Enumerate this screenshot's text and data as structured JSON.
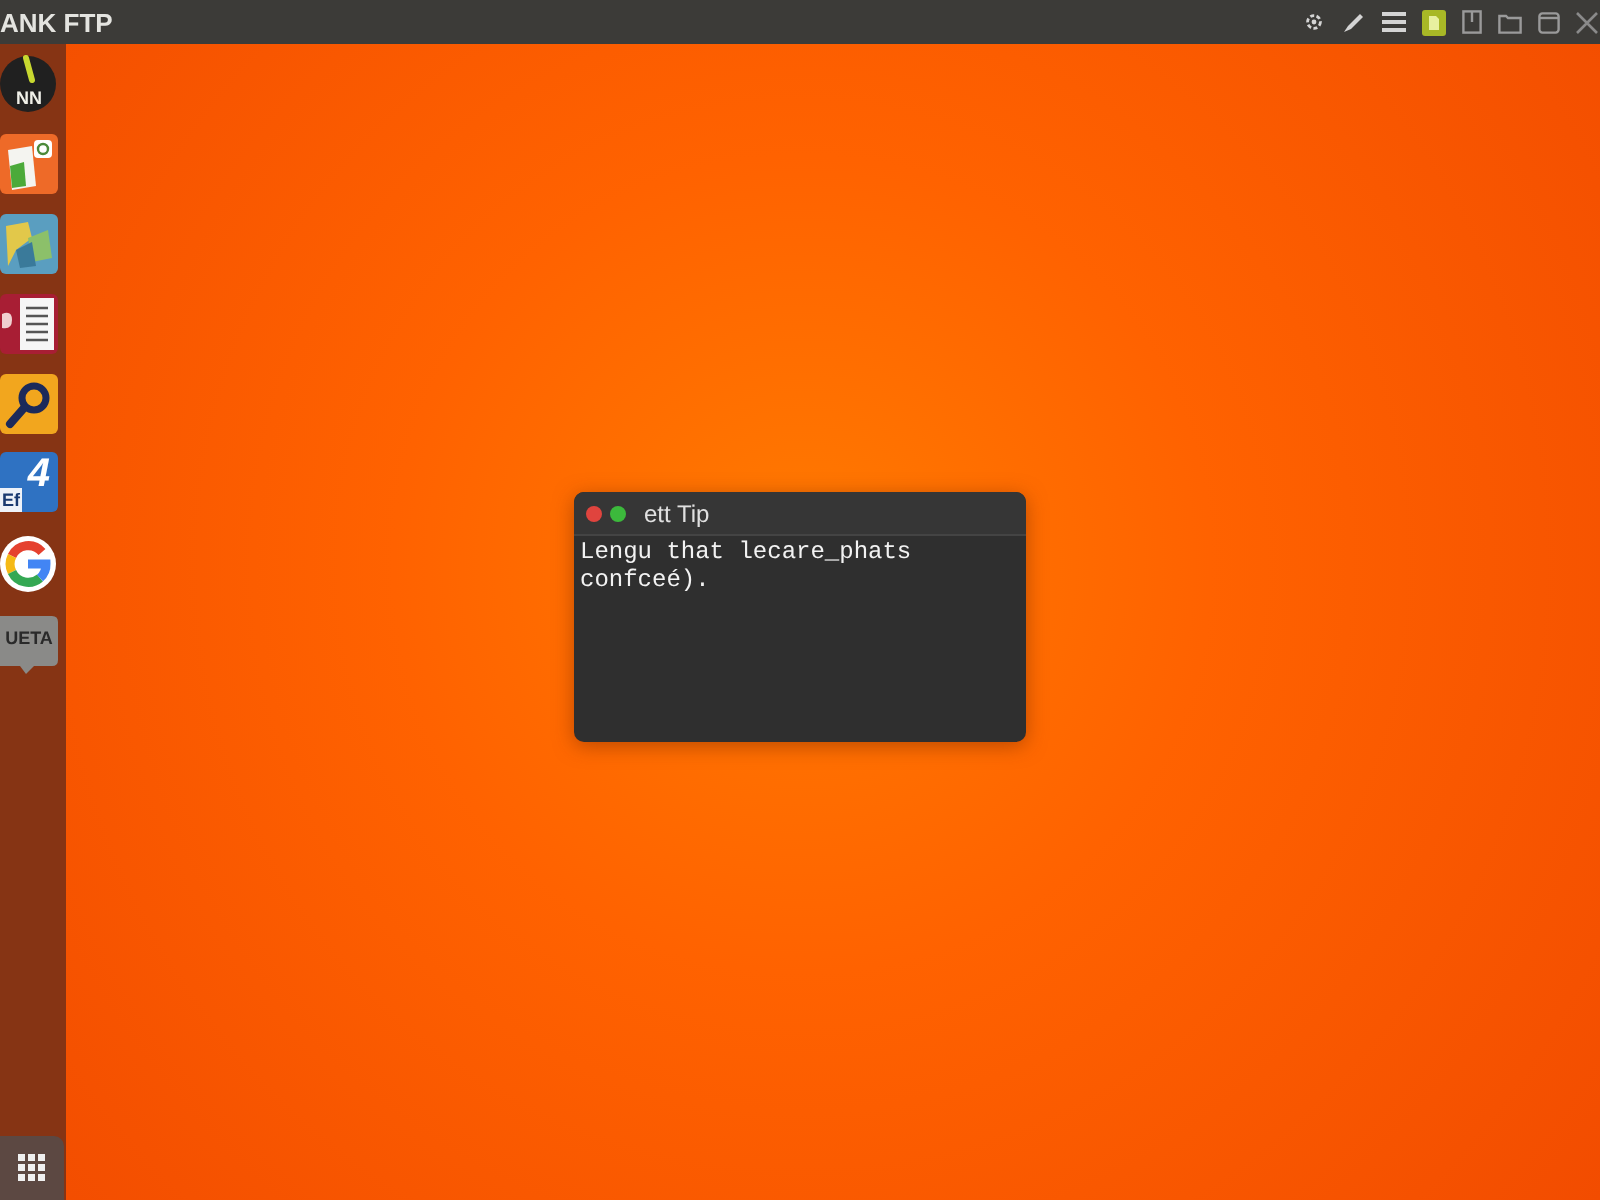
{
  "top_bar": {
    "title": "ANK FTP",
    "indicators": [
      {
        "kind": "gear"
      },
      {
        "kind": "pen"
      },
      {
        "kind": "menu"
      },
      {
        "kind": "tile"
      },
      {
        "kind": "book"
      },
      {
        "kind": "folder"
      },
      {
        "kind": "window"
      },
      {
        "kind": "close"
      }
    ]
  },
  "dock": {
    "items": [
      {
        "kind": "dial",
        "label": "NN"
      },
      {
        "kind": "files"
      },
      {
        "kind": "map"
      },
      {
        "kind": "document"
      },
      {
        "kind": "search"
      },
      {
        "kind": "number",
        "label": "4",
        "sublabel": "Ef"
      },
      {
        "kind": "google"
      },
      {
        "kind": "bubble",
        "label": "UETA"
      }
    ],
    "apps_button": {
      "kind": "grid"
    }
  },
  "terminal": {
    "title": "ett Tip",
    "buttons": [
      {
        "color": "#e0443e"
      },
      {
        "color": "#3cb93c"
      }
    ],
    "lines": [
      "Lengu that lecare_phats",
      "confceé)."
    ]
  }
}
